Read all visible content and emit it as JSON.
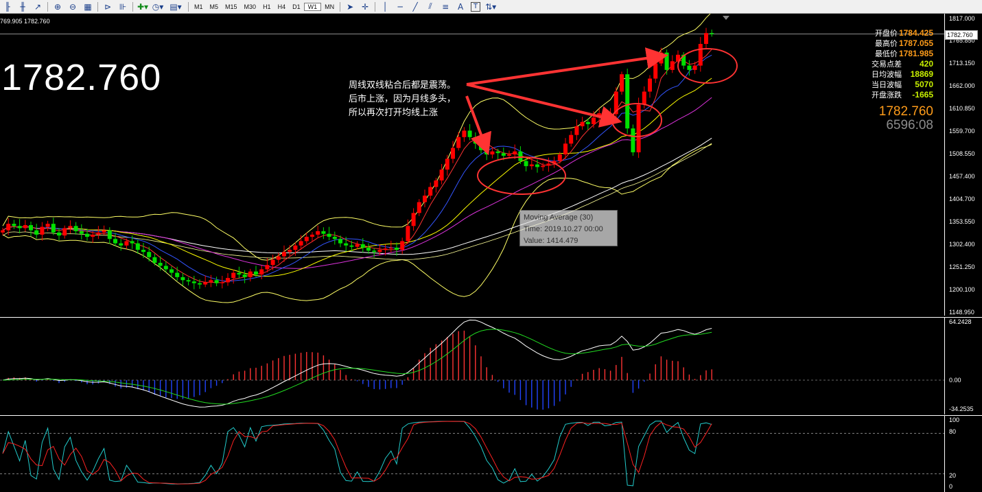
{
  "toolbar": {
    "icons": [
      "bar-chart-icon",
      "candlestick-icon",
      "line-chart-icon",
      "zoom-in-icon",
      "zoom-out-icon",
      "tile-windows-icon",
      "auto-scroll-icon",
      "chart-shift-icon",
      "indicators-icon",
      "periods-icon",
      "templates-icon"
    ],
    "timeframes": [
      "M1",
      "M5",
      "M15",
      "M30",
      "H1",
      "H4",
      "D1",
      "W1",
      "MN"
    ],
    "active_timeframe": "W1",
    "draw_tools": [
      "cursor-icon",
      "crosshair-icon",
      "vertical-line-icon",
      "horizontal-line-icon",
      "trendline-icon",
      "equidistant-channel-icon",
      "fibonacci-icon",
      "text-icon",
      "text-label-icon",
      "arrows-icon"
    ],
    "draw_labels": {
      "text_tool": "A",
      "label_tool": "T"
    }
  },
  "header": {
    "ohlc_text": "769.905 1782.760"
  },
  "big_price": "1782.760",
  "annotation": [
    "周线双线粘合后都是震荡。",
    "后市上涨，因为月线多头，",
    "所以再次打开均线上涨"
  ],
  "tooltip": {
    "line1": "Moving Average (30)",
    "line2": "Time: 2019.10.27 00:00",
    "line3": "Value: 1414.479"
  },
  "info": {
    "rows": [
      {
        "label": "开盘价",
        "value": "1784.425",
        "color": "#ff9c1a"
      },
      {
        "label": "最高价",
        "value": "1787.055",
        "color": "#ff9c1a"
      },
      {
        "label": "最低价",
        "value": "1781.985",
        "color": "#ff9c1a"
      },
      {
        "label": "交易点差",
        "value": "420",
        "color": "#c8f000"
      },
      {
        "label": "日均波幅",
        "value": "18869",
        "color": "#c8f000"
      },
      {
        "label": "当日波幅",
        "value": "5070",
        "color": "#c8f000"
      },
      {
        "label": "开盘涨跌",
        "value": "-1665",
        "color": "#c8f000"
      }
    ],
    "price": "1782.760",
    "timer": "6596:08"
  },
  "current_price_label": "1782.760",
  "price_axis": {
    "ticks": [
      "1817.000",
      "1765.850",
      "1713.150",
      "1662.000",
      "1610.850",
      "1559.700",
      "1508.550",
      "1457.400",
      "1404.700",
      "1353.550",
      "1302.400",
      "1251.250",
      "1200.100",
      "1148.950"
    ]
  },
  "macd_axis": {
    "ticks": [
      "64.2428",
      "0.00",
      "-34.2535"
    ]
  },
  "stoch_axis": {
    "ticks": [
      "100",
      "80",
      "20",
      "0"
    ]
  },
  "chart_data": {
    "type": "candlestick",
    "close_series": [
      1330,
      1345,
      1340,
      1335,
      1342,
      1330,
      1320,
      1338,
      1345,
      1325,
      1318,
      1335,
      1340,
      1328,
      1322,
      1315,
      1320,
      1325,
      1330,
      1310,
      1300,
      1295,
      1305,
      1300,
      1285,
      1280,
      1268,
      1255,
      1248,
      1240,
      1232,
      1222,
      1215,
      1212,
      1208,
      1205,
      1210,
      1215,
      1208,
      1210,
      1220,
      1232,
      1228,
      1222,
      1235,
      1228,
      1240,
      1250,
      1262,
      1270,
      1280,
      1285,
      1295,
      1305,
      1315,
      1320,
      1328,
      1322,
      1315,
      1310,
      1300,
      1295,
      1292,
      1298,
      1290,
      1283,
      1280,
      1285,
      1288,
      1290,
      1285,
      1305,
      1340,
      1370,
      1395,
      1410,
      1430,
      1445,
      1470,
      1495,
      1520,
      1545,
      1560,
      1545,
      1530,
      1515,
      1505,
      1512,
      1508,
      1502,
      1505,
      1512,
      1490,
      1478,
      1482,
      1476,
      1479,
      1484,
      1490,
      1505,
      1530,
      1550,
      1570,
      1580,
      1575,
      1590,
      1600,
      1595,
      1598,
      1650,
      1690,
      1565,
      1510,
      1620,
      1650,
      1680,
      1715,
      1740,
      1700,
      1720,
      1735,
      1710,
      1700,
      1710,
      1760,
      1785,
      1782.76
    ],
    "up_color": "#ff0000",
    "down_color": "#00e000",
    "series": [
      {
        "name": "Moving Average (30)",
        "tooltip_value": "1414.479"
      }
    ],
    "ylim": [
      1148.95,
      1817.0
    ]
  }
}
